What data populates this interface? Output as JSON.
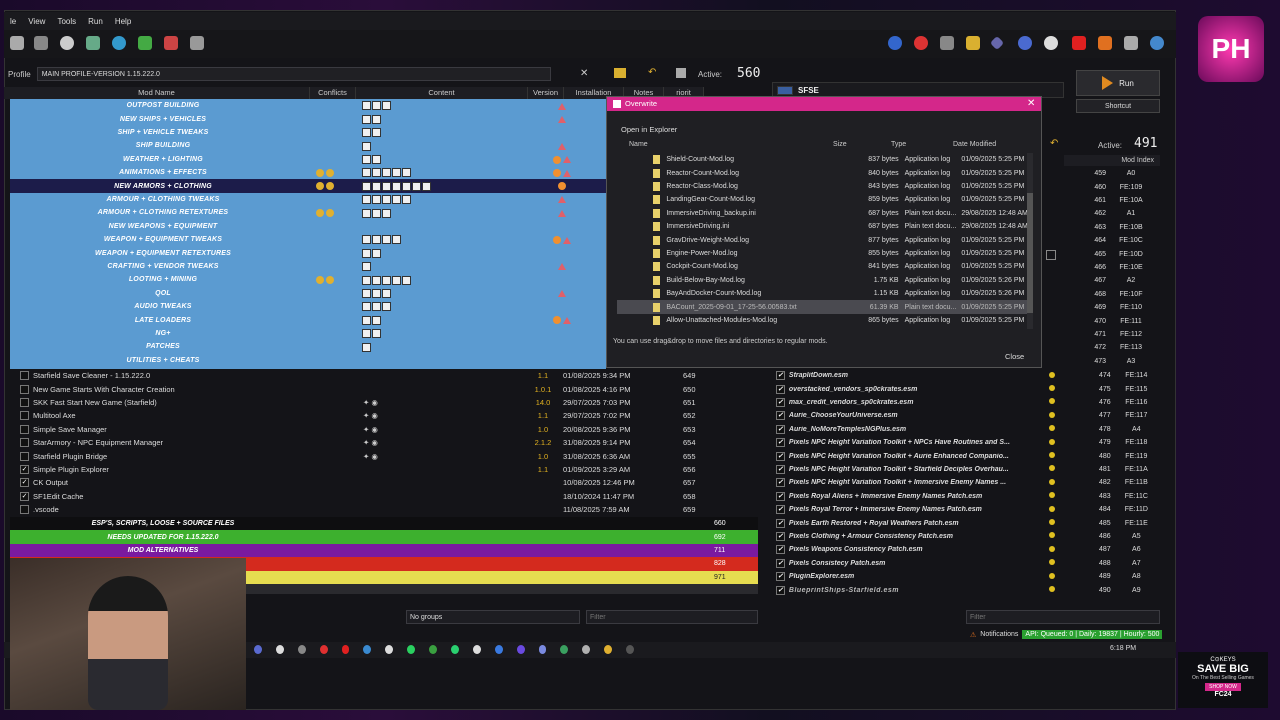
{
  "menu": [
    "le",
    "View",
    "Tools",
    "Run",
    "Help"
  ],
  "profile": {
    "label": "Profile",
    "value": "MAIN PROFILE-VERSION 1.15.222.0",
    "active_label": "Active:",
    "active_count": "560"
  },
  "run": {
    "label": "Run",
    "shortcut": "Shortcut",
    "sfse": "SFSE"
  },
  "columns": {
    "name": "Mod Name",
    "conflicts": "Conflicts",
    "content": "Content",
    "version": "Version",
    "installation": "Installation",
    "notes": "Notes",
    "priority": "riorit"
  },
  "separators": [
    "OUTPOST BUILDING",
    "NEW SHIPS + VEHICLES",
    "SHIP + VEHICLE TWEAKS",
    "SHIP BUILDING",
    "WEATHER + LIGHTING",
    "ANIMATIONS + EFFECTS",
    "NEW ARMORS + CLOTHING",
    "ARMOUR + CLOTHING TWEAKS",
    "ARMOUR + CLOTHING RETEXTURES",
    "NEW WEAPONS + EQUIPMENT",
    "WEAPON + EQUIPMENT TWEAKS",
    "WEAPON + EQUIPMENT RETEXTURES",
    "CRAFTING + VENDOR TWEAKS",
    "LOOTING + MINING",
    "QOL",
    "AUDIO TWEAKS",
    "LATE LOADERS",
    "NG+",
    "PATCHES",
    "UTILITIES + CHEATS"
  ],
  "plain_mods": [
    {
      "name": "Starfield Save Cleaner - 1.15.222.0",
      "version": "1.1",
      "date": "01/08/2025 9:34 PM",
      "prio": "649",
      "checked": false
    },
    {
      "name": "New Game Starts With Character Creation",
      "version": "1.0.1",
      "date": "01/08/2025 4:16 PM",
      "prio": "650",
      "checked": false
    },
    {
      "name": "SKK Fast Start New Game (Starfield)",
      "version": "14.0",
      "date": "29/07/2025 7:03 PM",
      "prio": "651",
      "checked": false
    },
    {
      "name": "Multitool Axe",
      "version": "1.1",
      "date": "29/07/2025 7:02 PM",
      "prio": "652",
      "checked": false
    },
    {
      "name": "Simple Save Manager",
      "version": "1.0",
      "date": "20/08/2025 9:36 PM",
      "prio": "653",
      "checked": false
    },
    {
      "name": "StarArmory - NPC Equipment Manager",
      "version": "2.1.2",
      "date": "31/08/2025 9:14 PM",
      "prio": "654",
      "checked": false
    },
    {
      "name": "Starfield Plugin Bridge",
      "version": "1.0",
      "date": "31/08/2025 6:36 AM",
      "prio": "655",
      "checked": false
    },
    {
      "name": "Simple Plugin Explorer",
      "version": "1.1",
      "date": "01/09/2025 3:29 AM",
      "prio": "656",
      "checked": true
    },
    {
      "name": "CK Output",
      "version": "",
      "date": "10/08/2025 12:46 PM",
      "prio": "657",
      "checked": true
    },
    {
      "name": "SF1Edit Cache",
      "version": "",
      "date": "18/10/2024 11:47 PM",
      "prio": "658",
      "checked": true
    },
    {
      "name": ".vscode",
      "version": "",
      "date": "11/08/2025 7:59 AM",
      "prio": "659",
      "checked": false
    }
  ],
  "bottom_separators": [
    {
      "name": "ESP'S, SCRIPTS, LOOSE + SOURCE FILES",
      "prio": "660",
      "color": "#0e0e10"
    },
    {
      "name": "NEEDS UPDATED FOR 1.15.222.0",
      "prio": "692",
      "color": "#3db02e"
    },
    {
      "name": "MOD ALTERNATIVES",
      "prio": "711",
      "color": "#7a1aa0"
    },
    {
      "name": "",
      "prio": "828",
      "color": "#d42a1e"
    },
    {
      "name": "",
      "prio": "971",
      "color": "#e6dc50"
    }
  ],
  "groups": {
    "value": "No groups",
    "filter_placeholder": "Filter"
  },
  "dialog": {
    "title": "Overwrite",
    "open_in_explorer": "Open in Explorer",
    "headers": {
      "name": "Name",
      "size": "Size",
      "type": "Type",
      "date": "Date Modified"
    },
    "files": [
      {
        "name": "Shield-Count-Mod.log",
        "size": "837 bytes",
        "type": "Application log",
        "date": "01/09/2025 5:25 PM"
      },
      {
        "name": "Reactor-Count-Mod.log",
        "size": "840 bytes",
        "type": "Application log",
        "date": "01/09/2025 5:25 PM"
      },
      {
        "name": "Reactor-Class-Mod.log",
        "size": "843 bytes",
        "type": "Application log",
        "date": "01/09/2025 5:25 PM"
      },
      {
        "name": "LandingGear-Count-Mod.log",
        "size": "859 bytes",
        "type": "Application log",
        "date": "01/09/2025 5:25 PM"
      },
      {
        "name": "ImmersiveDriving_backup.ini",
        "size": "687 bytes",
        "type": "Plain text docu...",
        "date": "29/08/2025 12:48 AM"
      },
      {
        "name": "ImmersiveDriving.ini",
        "size": "687 bytes",
        "type": "Plain text docu...",
        "date": "29/08/2025 12:48 AM"
      },
      {
        "name": "GravDrive-Weight-Mod.log",
        "size": "877 bytes",
        "type": "Application log",
        "date": "01/09/2025 5:25 PM"
      },
      {
        "name": "Engine-Power-Mod.log",
        "size": "855 bytes",
        "type": "Application log",
        "date": "01/09/2025 5:25 PM"
      },
      {
        "name": "Cockpit-Count-Mod.log",
        "size": "841 bytes",
        "type": "Application log",
        "date": "01/09/2025 5:25 PM"
      },
      {
        "name": "Build-Below-Bay-Mod.log",
        "size": "1.75 KB",
        "type": "Application log",
        "date": "01/09/2025 5:26 PM"
      },
      {
        "name": "BayAndDocker-Count-Mod.log",
        "size": "1.15 KB",
        "type": "Application log",
        "date": "01/09/2025 5:26 PM"
      },
      {
        "name": "BACount_2025-09-01_17-25-56.00583.txt",
        "size": "61.39 KB",
        "type": "Plain text docu...",
        "date": "01/09/2025 5:25 PM"
      },
      {
        "name": "Allow-Unattached-Modules-Mod.log",
        "size": "865 bytes",
        "type": "Application log",
        "date": "01/09/2025 5:25 PM"
      }
    ],
    "hint": "You can use drag&drop to move files and directories to regular mods.",
    "close": "Close"
  },
  "plugins": {
    "active_label": "Active:",
    "active_count": "491",
    "index_header": "Mod Index",
    "index_top": [
      {
        "p": "459",
        "i": "A0"
      },
      {
        "p": "460",
        "i": "FE:109"
      },
      {
        "p": "461",
        "i": "FE:10A"
      },
      {
        "p": "462",
        "i": "A1"
      },
      {
        "p": "463",
        "i": "FE:10B"
      },
      {
        "p": "464",
        "i": "FE:10C"
      },
      {
        "p": "465",
        "i": "FE:10D"
      },
      {
        "p": "466",
        "i": "FE:10E"
      },
      {
        "p": "467",
        "i": "A2"
      },
      {
        "p": "468",
        "i": "FE:10F"
      },
      {
        "p": "469",
        "i": "FE:110"
      },
      {
        "p": "470",
        "i": "FE:111"
      },
      {
        "p": "471",
        "i": "FE:112"
      },
      {
        "p": "472",
        "i": "FE:113"
      },
      {
        "p": "473",
        "i": "A3"
      }
    ],
    "rows": [
      {
        "name": "StraplitDown.esm",
        "p": "474",
        "i": "FE:114"
      },
      {
        "name": "overstacked_vendors_sp0ckrates.esm",
        "p": "475",
        "i": "FE:115"
      },
      {
        "name": "max_credit_vendors_sp0ckrates.esm",
        "p": "476",
        "i": "FE:116"
      },
      {
        "name": "Aurie_ChooseYourUniverse.esm",
        "p": "477",
        "i": "FE:117"
      },
      {
        "name": "Aurie_NoMoreTemplesNGPlus.esm",
        "p": "478",
        "i": "A4"
      },
      {
        "name": "Pixels NPC Height Variation Toolkit + NPCs Have Routines and S...",
        "p": "479",
        "i": "FE:118"
      },
      {
        "name": "Pixels NPC Height Variation Toolkit + Aurie Enhanced Companio...",
        "p": "480",
        "i": "FE:119"
      },
      {
        "name": "Pixels NPC Height Variation Toolkit + Starfield Deciples Overhau...",
        "p": "481",
        "i": "FE:11A"
      },
      {
        "name": "Pixels NPC Height Variation Toolkit + Immersive Enemy Names ...",
        "p": "482",
        "i": "FE:11B"
      },
      {
        "name": "Pixels Royal Aliens + Immersive Enemy Names Patch.esm",
        "p": "483",
        "i": "FE:11C"
      },
      {
        "name": "Pixels Royal Terror + Immersive Enemy Names Patch.esm",
        "p": "484",
        "i": "FE:11D"
      },
      {
        "name": "Pixels Earth Restored + Royal Weathers Patch.esm",
        "p": "485",
        "i": "FE:11E"
      },
      {
        "name": "Pixels Clothing + Armour Consistency Patch.esm",
        "p": "486",
        "i": "A5"
      },
      {
        "name": "Pixels Weapons Consistency Patch.esm",
        "p": "487",
        "i": "A6"
      },
      {
        "name": "Pixels Consistecy Patch.esm",
        "p": "488",
        "i": "A7"
      },
      {
        "name": "PluginExplorer.esm",
        "p": "489",
        "i": "A8"
      },
      {
        "name": "BlueprintShips-Starfield.esm",
        "p": "490",
        "i": "A9"
      }
    ],
    "filter_placeholder": "Filter"
  },
  "status": {
    "notifications": "Notifications",
    "api": "API: Queued: 0 | Daily: 19837 | Hourly: 500"
  },
  "clock": "6:18 PM",
  "ad": {
    "brand": "C⊙KEYS",
    "headline": "SAVE BIG",
    "sub": "On The Best Selling Games",
    "cta": "SHOP NOW",
    "game": "FC24"
  },
  "logo": "PH"
}
